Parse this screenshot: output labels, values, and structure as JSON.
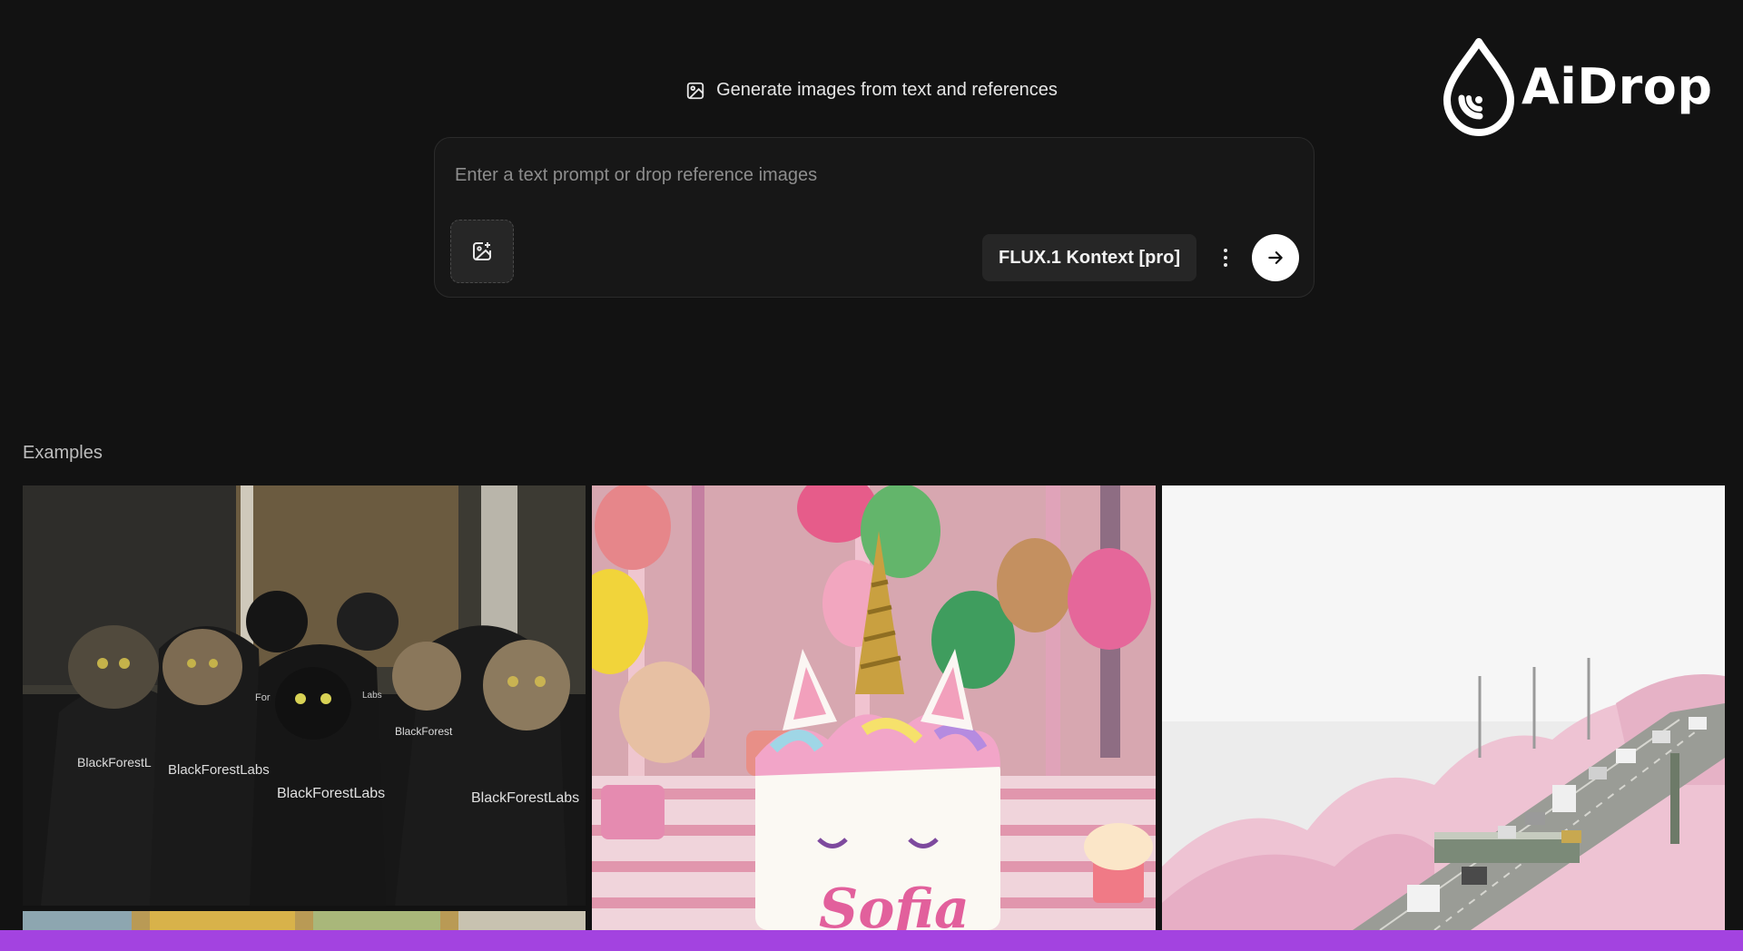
{
  "brand": {
    "name": "AiDrop",
    "color": "#ffffff"
  },
  "header": {
    "icon": "image-icon",
    "text": "Generate images from text and references"
  },
  "prompt": {
    "value": "",
    "placeholder": "Enter a text prompt or drop reference images",
    "upload_icon": "image-add-icon",
    "model_label": "FLUX.1 Kontext [pro]",
    "more_icon": "more-vertical-icon",
    "send_icon": "arrow-right-icon"
  },
  "examples": {
    "label": "Examples",
    "items": [
      {
        "subject": "cats-in-hoodies",
        "captions": [
          "BlackForestL",
          "BlackForestLabs",
          "For",
          "Labs",
          "BlackForestLabs",
          "BlackForest",
          "BlackForestLabs"
        ]
      },
      {
        "subject": "unicorn-birthday-cake",
        "captions": [
          "Sofia"
        ]
      },
      {
        "subject": "cherry-blossom-highway",
        "captions": []
      }
    ]
  },
  "colors": {
    "background": "#121212",
    "accent_bar": "#a343e0",
    "send_button": "#ffffff"
  }
}
